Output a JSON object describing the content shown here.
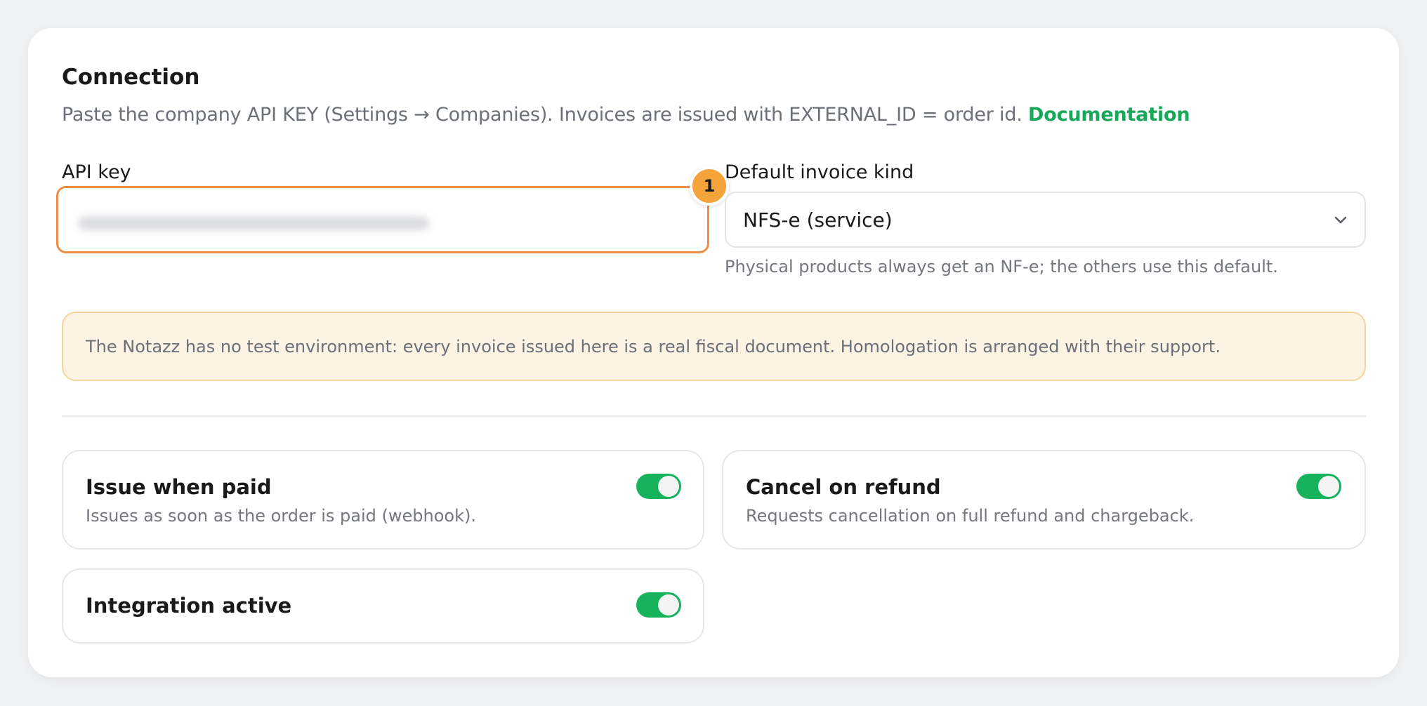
{
  "connection": {
    "title": "Connection",
    "description": "Paste the company API KEY (Settings → Companies). Invoices are issued with EXTERNAL_ID = order id.",
    "doc_link": "Documentation"
  },
  "api_key": {
    "label": "API key",
    "badge": "1"
  },
  "invoice_kind": {
    "label": "Default invoice kind",
    "selected": "NFS-e (service)",
    "hint": "Physical products always get an NF-e; the others use this default."
  },
  "notice": {
    "text": "The Notazz has no test environment: every invoice issued here is a real fiscal document. Homologation is arranged with their support."
  },
  "toggles": {
    "issue_when_paid": {
      "title": "Issue when paid",
      "description": "Issues as soon as the order is paid (webhook).",
      "on": true
    },
    "cancel_on_refund": {
      "title": "Cancel on refund",
      "description": "Requests cancellation on full refund and chargeback.",
      "on": true
    },
    "integration_active": {
      "title": "Integration active",
      "on": true
    }
  },
  "colors": {
    "accent_green": "#16b25c",
    "link_green": "#18a85a",
    "focus_orange": "#ef8e45",
    "badge_orange": "#f4a43a",
    "notice_bg": "#fdf3e4"
  }
}
